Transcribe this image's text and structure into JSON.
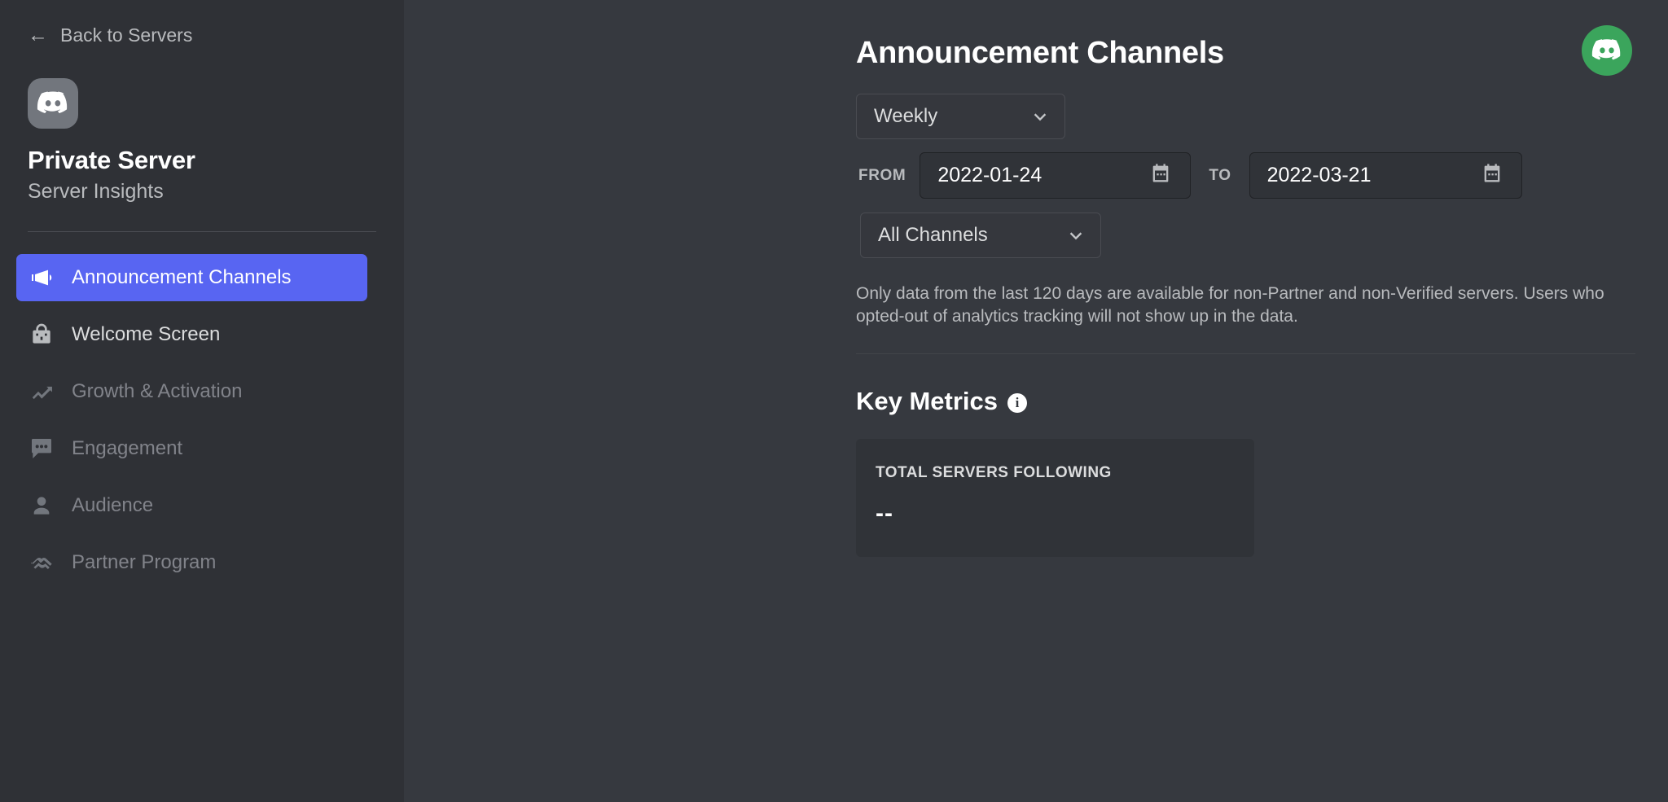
{
  "sidebar": {
    "back_label": "Back to Servers",
    "back_icon": "arrow-left-icon",
    "server_avatar_icon": "discord-logo-icon",
    "server_name": "Private Server",
    "server_subtitle": "Server Insights",
    "items": [
      {
        "label": "Announcement Channels",
        "icon": "megaphone-icon",
        "state": "active"
      },
      {
        "label": "Welcome Screen",
        "icon": "welcome-screen-icon",
        "state": "enabled"
      },
      {
        "label": "Growth & Activation",
        "icon": "trending-up-icon",
        "state": "disabled"
      },
      {
        "label": "Engagement",
        "icon": "chat-bubble-icon",
        "state": "disabled"
      },
      {
        "label": "Audience",
        "icon": "person-icon",
        "state": "disabled"
      },
      {
        "label": "Partner Program",
        "icon": "handshake-icon",
        "state": "disabled"
      }
    ]
  },
  "header": {
    "title": "Announcement Channels",
    "badge_icon": "discord-logo-icon"
  },
  "filters": {
    "period": {
      "value": "Weekly",
      "chevron_icon": "chevron-down-icon"
    },
    "from_label": "FROM",
    "from_date": "2022-01-24",
    "to_label": "TO",
    "to_date": "2022-03-21",
    "calendar_icon": "calendar-icon",
    "channel": {
      "value": "All Channels",
      "chevron_icon": "chevron-down-icon"
    }
  },
  "disclaimer": "Only data from the last 120 days are available for non-Partner and non-Verified servers. Users who opted-out of analytics tracking will not show up in the data.",
  "key_metrics": {
    "title": "Key Metrics",
    "info_icon": "info-icon",
    "info_glyph": "i",
    "cards": [
      {
        "label": "TOTAL SERVERS FOLLOWING",
        "value": "--"
      }
    ]
  },
  "colors": {
    "accent": "#5865f2",
    "badge_green": "#3ba55c",
    "sidebar_bg": "#2f3136",
    "main_bg": "#36393f"
  }
}
